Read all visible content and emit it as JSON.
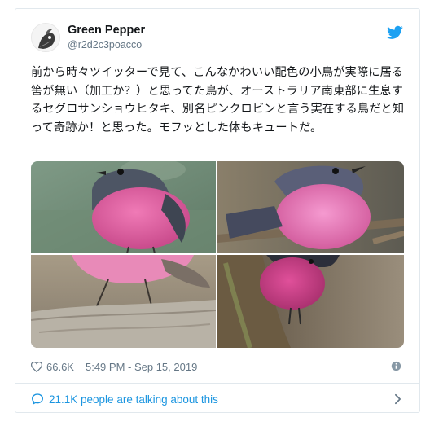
{
  "user": {
    "name": "Green Pepper",
    "handle": "@r2d2c3poacco"
  },
  "tweet": {
    "text": "前から時々ツイッターで見て、こんなかわいい配色の小鳥が実際に居る筈が無い（加工か？）と思ってた鳥が、オーストラリア南東部に生息するセグロサンショウヒタキ、別名ピンクロビンと言う実在する鳥だと知って奇跡か！と思った。モフッとした体もキュートだ。",
    "likes": "66.6K",
    "timestamp": "5:49 PM - Sep 15, 2019"
  },
  "conversation": {
    "label": "21.1K people are talking about this"
  },
  "icons": {
    "brand": "twitter-bird-icon",
    "like": "heart-icon",
    "info": "info-icon",
    "reply": "speech-bubble-icon",
    "more": "chevron-right-icon"
  },
  "colors": {
    "brand_blue": "#1da1f2",
    "link_blue": "#1b95e0",
    "secondary_text": "#657786",
    "border": "#e1e8ed",
    "bird_pink": "#d8578f"
  }
}
